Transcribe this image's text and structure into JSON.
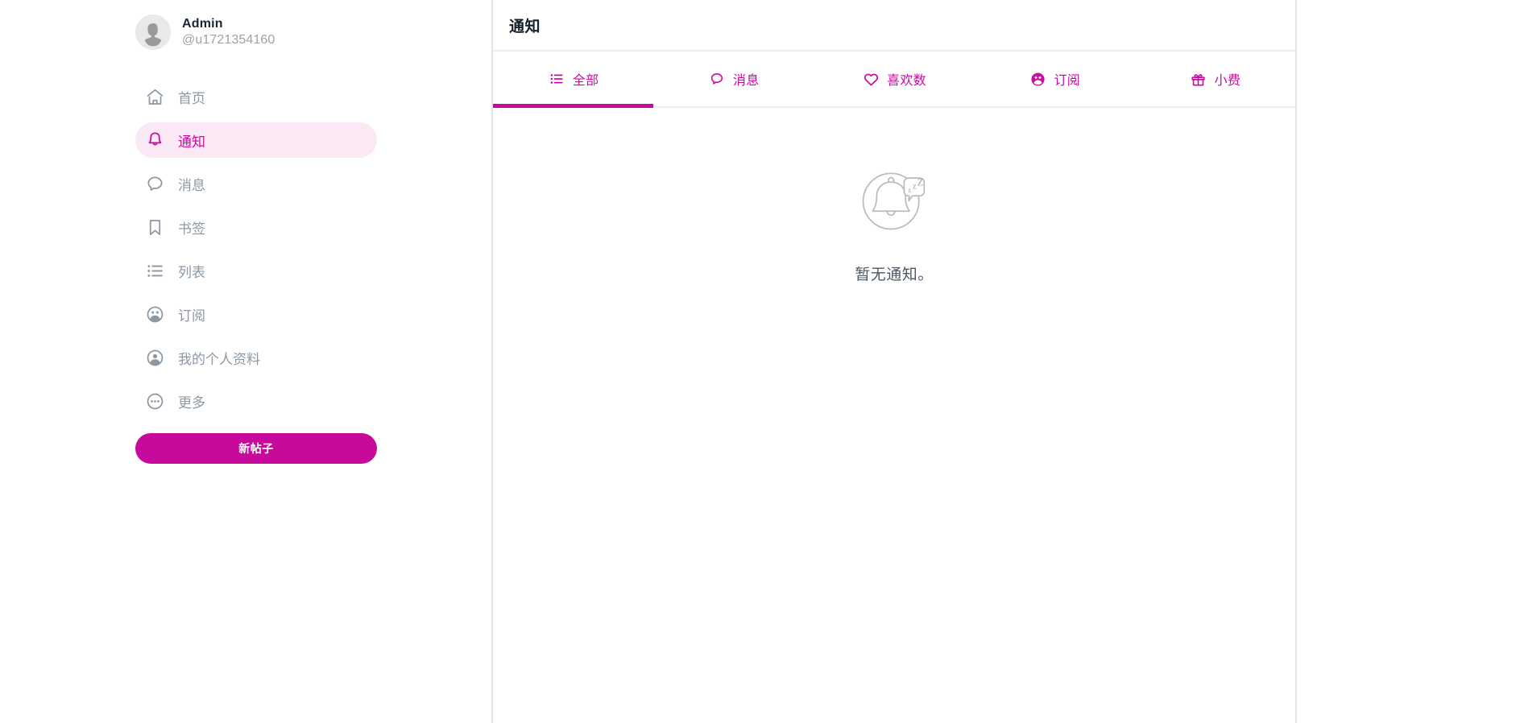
{
  "theme": {
    "accent": "#c70a9c",
    "accent_text": "#cc0aa4",
    "active_pill_bg": "#fae8f5",
    "muted": "#8d98a3",
    "border": "#e2e4e9",
    "title_color": "#14202c"
  },
  "sidebar": {
    "profile": {
      "name": "Admin",
      "handle": "@u1721354160",
      "avatar_icon": "user-avatar-placeholder-icon"
    },
    "items": [
      {
        "label": "首页",
        "icon": "home-icon",
        "active": false,
        "name": "sidebar-item-home"
      },
      {
        "label": "通知",
        "icon": "bell-icon",
        "active": true,
        "name": "sidebar-item-notifications"
      },
      {
        "label": "消息",
        "icon": "chat-bubble-icon",
        "active": false,
        "name": "sidebar-item-messages"
      },
      {
        "label": "书签",
        "icon": "bookmark-icon",
        "active": false,
        "name": "sidebar-item-bookmarks"
      },
      {
        "label": "列表",
        "icon": "list-icon",
        "active": false,
        "name": "sidebar-item-lists"
      },
      {
        "label": "订阅",
        "icon": "subscribers-icon",
        "active": false,
        "name": "sidebar-item-subscriptions"
      },
      {
        "label": "我的个人资料",
        "icon": "profile-circle-icon",
        "active": false,
        "name": "sidebar-item-my-profile"
      },
      {
        "label": "更多",
        "icon": "more-dots-icon",
        "active": false,
        "name": "sidebar-item-more"
      }
    ],
    "new_post_button": "新帖子"
  },
  "main": {
    "header_title": "通知",
    "tabs": [
      {
        "label": "全部",
        "icon": "list-icon",
        "active": true,
        "name": "tab-all"
      },
      {
        "label": "消息",
        "icon": "chat-bubble-icon",
        "active": false,
        "name": "tab-messages"
      },
      {
        "label": "喜欢数",
        "icon": "heart-icon",
        "active": false,
        "name": "tab-likes"
      },
      {
        "label": "订阅",
        "icon": "subscribers-icon",
        "active": false,
        "name": "tab-subscriptions"
      },
      {
        "label": "小费",
        "icon": "gift-icon",
        "active": false,
        "name": "tab-tips"
      }
    ],
    "empty_state": {
      "icon": "sleeping-bell-icon",
      "text": "暂无通知。"
    }
  }
}
